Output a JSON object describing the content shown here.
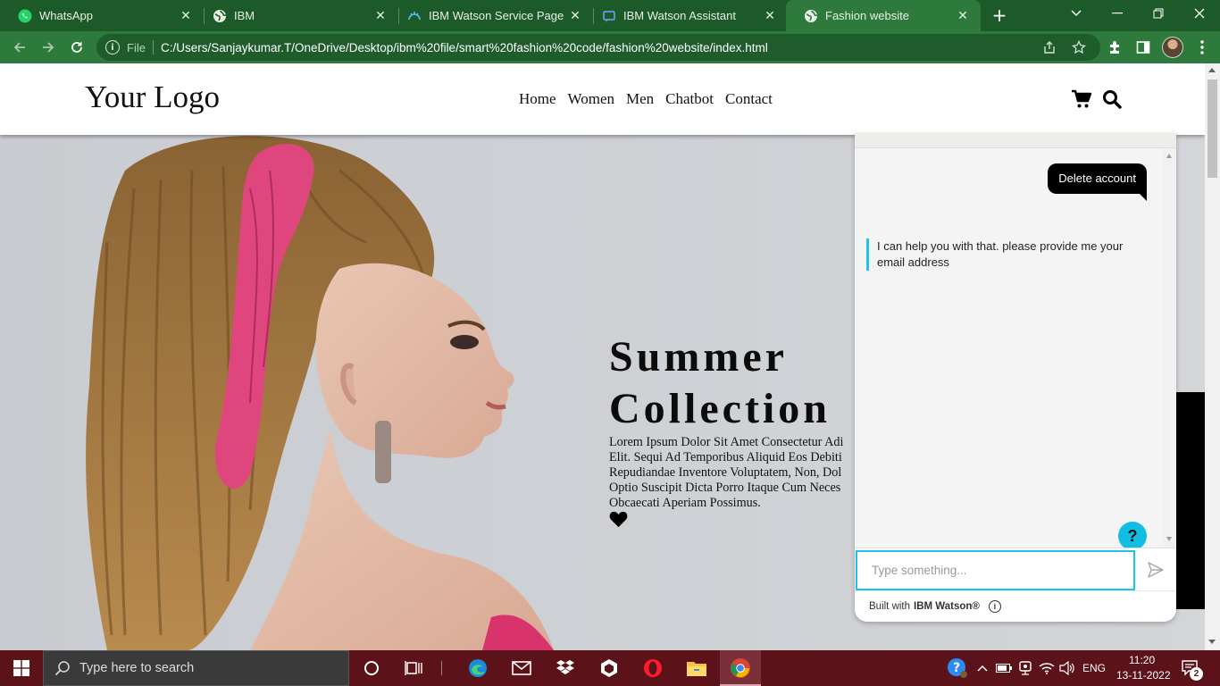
{
  "browser": {
    "tabs": [
      {
        "label": "WhatsApp",
        "icon": "whatsapp-icon",
        "active": false
      },
      {
        "label": "IBM",
        "icon": "globe-icon",
        "active": false
      },
      {
        "label": "IBM Watson Service Page",
        "icon": "watson-icon",
        "active": false
      },
      {
        "label": "IBM Watson Assistant",
        "icon": "assistant-icon",
        "active": false
      },
      {
        "label": "Fashion website",
        "icon": "globe-icon",
        "active": true
      }
    ],
    "address": {
      "scheme_label": "File",
      "url": "C:/Users/Sanjaykumar.T/OneDrive/Desktop/ibm%20file/smart%20fashion%20code/fashion%20website/index.html"
    }
  },
  "site": {
    "logo": "Your Logo",
    "nav": [
      "Home",
      "Women",
      "Men",
      "Chatbot",
      "Contact"
    ],
    "hero": {
      "title_line1": "Summer",
      "title_line2": "Collection",
      "text_lines": [
        "Lorem Ipsum Dolor Sit Amet Consectetur Adi",
        "Elit. Sequi Ad Temporibus Aliquid Eos Debiti",
        "Repudiandae Inventore Voluptatem, Non, Dol",
        "Optio Suscipit Dicta Porro Itaque Cum Neces",
        "Obcaecati Aperiam Possimus."
      ]
    }
  },
  "chat": {
    "user_message": "Delete account",
    "bot_message": "I can help you with that. please provide me your email address",
    "help_label": "?",
    "input_placeholder": "Type something...",
    "footer_prefix": "Built with",
    "footer_brand": "IBM Watson®"
  },
  "taskbar": {
    "search_placeholder": "Type here to search",
    "language": "ENG",
    "time": "11:20",
    "date": "13-11-2022",
    "notification_count": "2"
  },
  "colors": {
    "tab_strip": "#1c5a2a",
    "toolbar": "#2d7a3c",
    "chat_accent": "#1ec3e6",
    "taskbar": "#5b1218"
  }
}
